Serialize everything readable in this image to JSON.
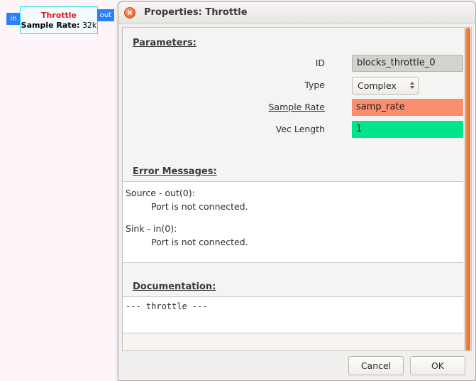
{
  "canvas": {
    "block": {
      "title": "Throttle",
      "param_label": "Sample Rate:",
      "param_value": "32k",
      "port_in": "in",
      "port_out": "out",
      "title_color": "#e01b1b",
      "border_color": "#21e0e0",
      "port_color": "#2a7fff",
      "background": "#fdf5fa"
    }
  },
  "dialog": {
    "title": "Properties: Throttle",
    "close_icon": "close-icon",
    "sections": {
      "parameters_heading": "Parameters:",
      "errors_heading": "Error Messages:",
      "documentation_heading": "Documentation:"
    },
    "parameters": [
      {
        "label": "ID",
        "underlined": false,
        "value": "blocks_throttle_0",
        "style": "grey"
      },
      {
        "label": "Type",
        "underlined": false,
        "value": "Complex",
        "style": "combo"
      },
      {
        "label": "Sample Rate",
        "underlined": true,
        "value": "samp_rate",
        "style": "orange"
      },
      {
        "label": "Vec Length",
        "underlined": false,
        "value": "1",
        "style": "green"
      }
    ],
    "errors": [
      {
        "header": "Source - out(0):",
        "detail": "Port is not connected."
      },
      {
        "header": "Sink - in(0):",
        "detail": "Port is not connected."
      }
    ],
    "documentation": "--- throttle ---",
    "buttons": {
      "cancel": "Cancel",
      "ok": "OK"
    },
    "colors": {
      "orange_field": "#fa8e6e",
      "green_field": "#00e58c",
      "grey_field": "#d4d2ce",
      "scrollbar": "#e5712f"
    }
  }
}
